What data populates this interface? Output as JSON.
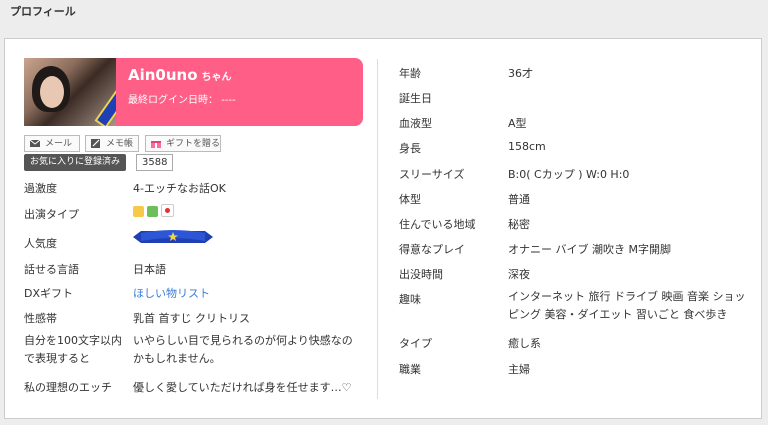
{
  "section_title": "プロフィール",
  "header": {
    "name": "Ain0uno",
    "honorific": "ちゃん",
    "last_login": "最終ログイン日時： ----"
  },
  "buttons": {
    "mail": "メール",
    "memo": "メモ帳",
    "gift": "ギフトを贈る",
    "favorite": "お気に入りに登録済み",
    "favorite_count": "3588"
  },
  "left": [
    {
      "label": "過激度",
      "value": "4-エッチなお話OK"
    },
    {
      "label": "出演タイプ",
      "value": ""
    },
    {
      "label": "人気度",
      "value": ""
    },
    {
      "label": "話せる言語",
      "value": "日本語"
    },
    {
      "label": "DXギフト",
      "value": "ほしい物リスト"
    },
    {
      "label": "性感帯",
      "value": "乳首 首すじ クリトリス"
    },
    {
      "label": "自分を100文字以内で表現すると",
      "value": "いやらしい目で見られるのが何より快感なのかもしれません。"
    },
    {
      "label": "私の理想のエッチ",
      "value": "優しく愛していただければ身を任せます…♡"
    }
  ],
  "right": [
    {
      "label": "年齢",
      "value": "36才"
    },
    {
      "label": "誕生日",
      "value": ""
    },
    {
      "label": "血液型",
      "value": "A型"
    },
    {
      "label": "身長",
      "value": "158cm"
    },
    {
      "label": "スリーサイズ",
      "value": "B:0( Cカップ ) W:0 H:0"
    },
    {
      "label": "体型",
      "value": "普通"
    },
    {
      "label": "住んでいる地域",
      "value": "秘密"
    },
    {
      "label": "得意なプレイ",
      "value": "オナニー バイブ 潮吹き M字開脚"
    },
    {
      "label": "出没時間",
      "value": "深夜"
    },
    {
      "label": "趣味",
      "value": "インターネット 旅行 ドライブ 映画 音楽 ショッピング 美容・ダイエット 習いごと 食べ歩き"
    },
    {
      "label": "タイプ",
      "value": "癒し系"
    },
    {
      "label": "職業",
      "value": "主婦"
    }
  ],
  "colors": {
    "header_pink": "#ff5f87",
    "link_blue": "#3a7bd5"
  }
}
